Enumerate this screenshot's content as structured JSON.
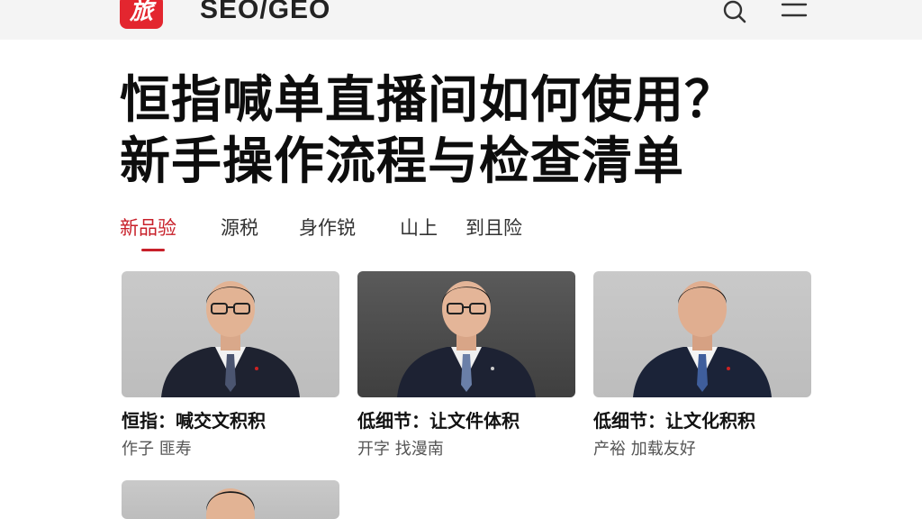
{
  "header": {
    "logo_text": "旅",
    "site_title": "SEO/GEO",
    "icons": [
      "search-icon",
      "menu-icon"
    ],
    "accent_color": "#e3262f"
  },
  "article": {
    "title_line1": "恒指喊单直播间如何使用？",
    "title_line2": "新手操作流程与检查清单"
  },
  "tabs": [
    {
      "label": "新品验",
      "active": true
    },
    {
      "label": "源税",
      "active": false
    },
    {
      "label": "身作锐",
      "active": false
    },
    {
      "label": "山上",
      "active": false
    },
    {
      "label": "到且险",
      "active": false
    }
  ],
  "cards": [
    {
      "title": "恒指：喊交文积积",
      "meta": "作子 匪寿",
      "image": "portrait-light"
    },
    {
      "title": "低细节：让文件体积",
      "meta": "开字 找漫南",
      "image": "portrait-dark"
    },
    {
      "title": "低细节：让文化积积",
      "meta": "产裕 加载友好",
      "image": "portrait-light"
    },
    {
      "title": "",
      "meta": "",
      "image": "portrait-light"
    }
  ]
}
